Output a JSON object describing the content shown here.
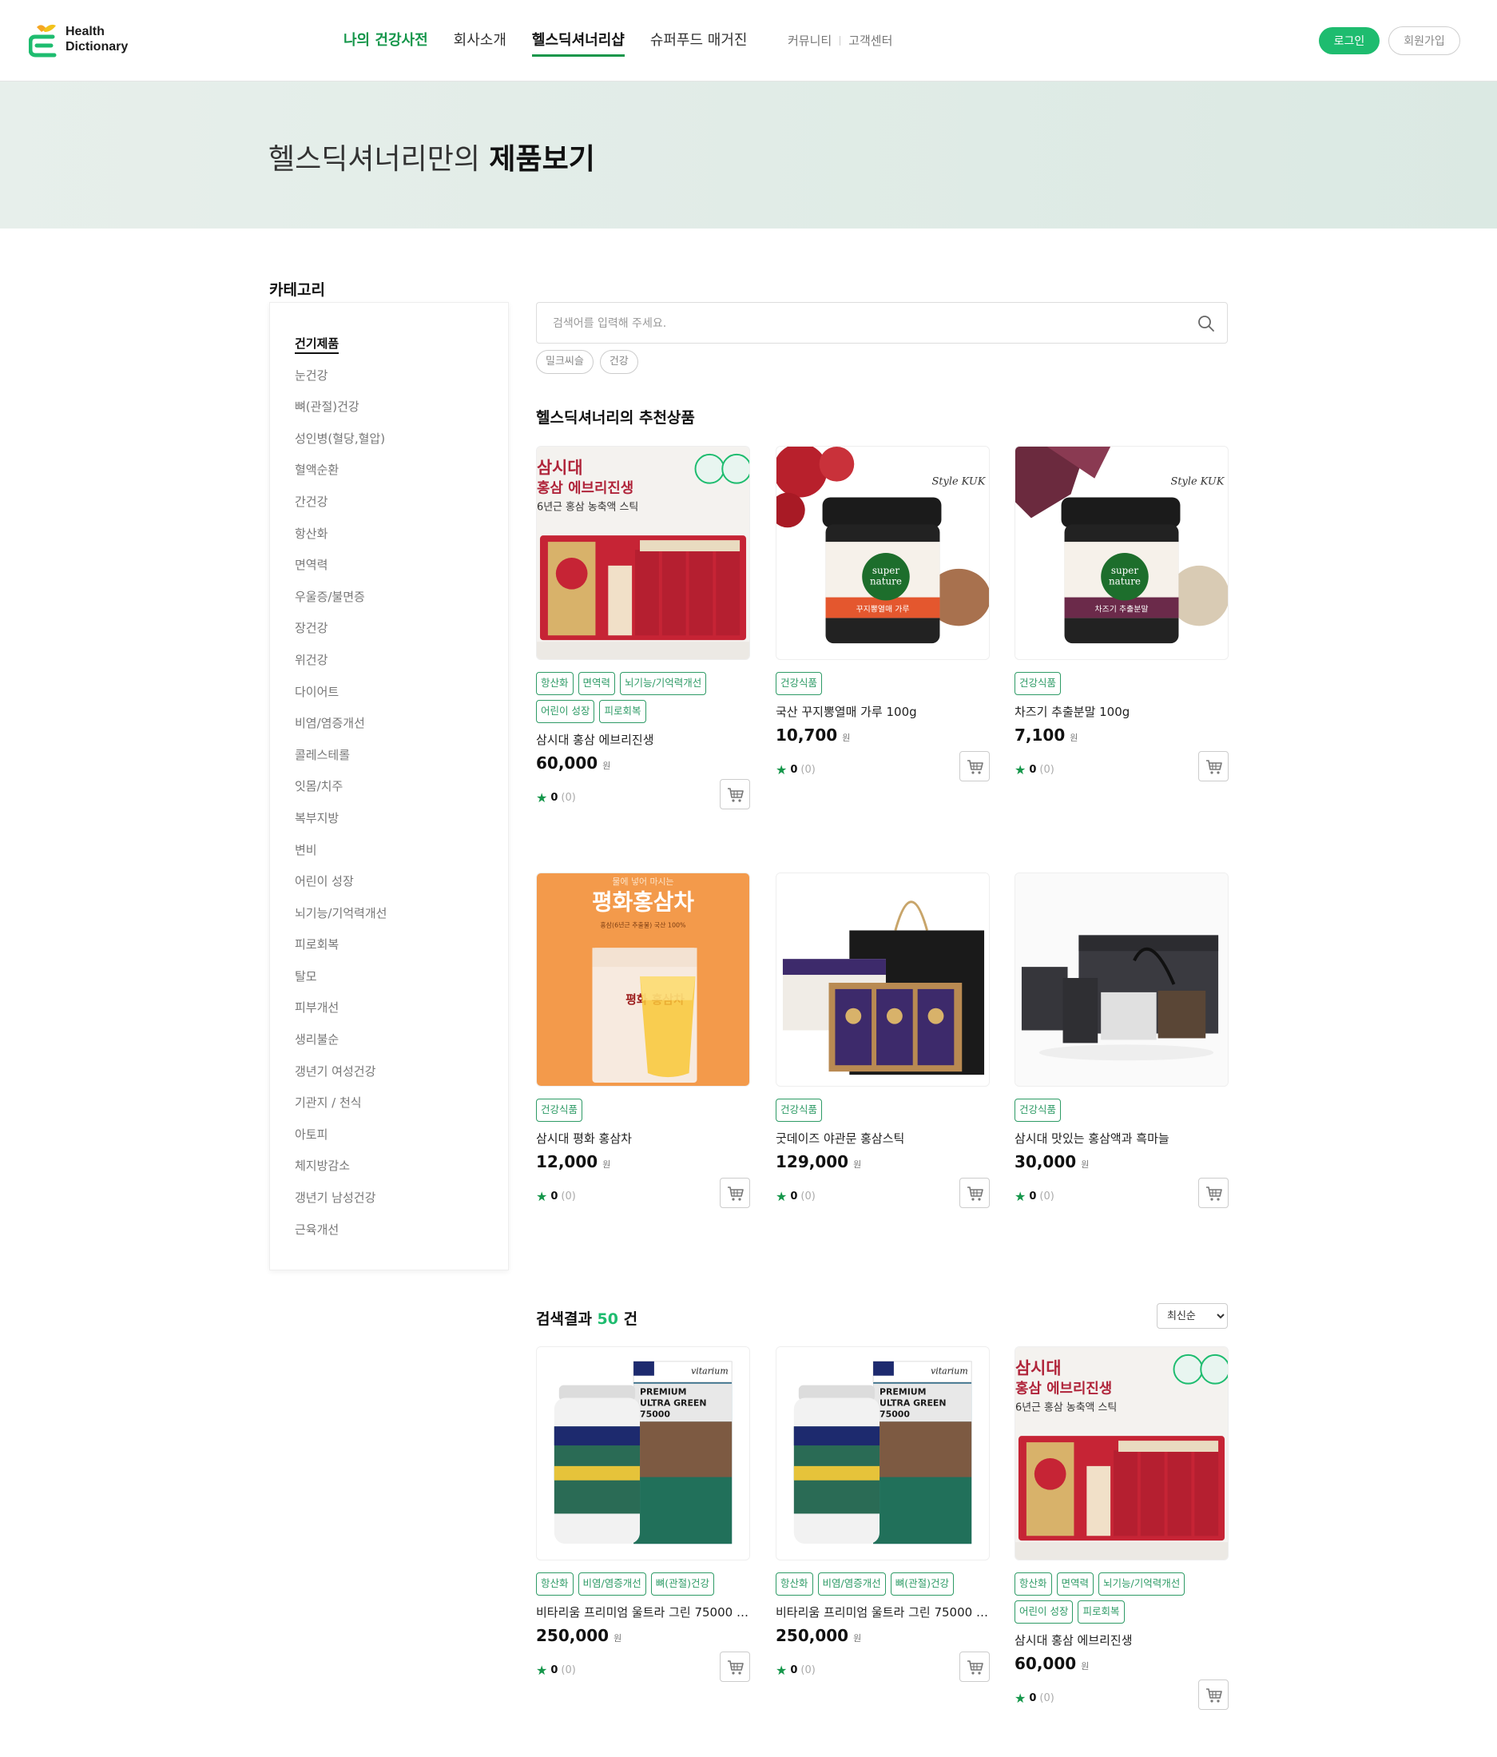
{
  "brand": {
    "line1": "Health",
    "line2": "Dictionary"
  },
  "nav": {
    "items": [
      "나의 건강사전",
      "회사소개",
      "헬스딕셔너리샵",
      "슈퍼푸드 매거진"
    ],
    "sub": [
      "커뮤니티",
      "고객센터"
    ],
    "login": "로그인",
    "join": "회원가입"
  },
  "hero": {
    "title_normal": "헬스딕셔너리만의 ",
    "title_bold": "제품보기"
  },
  "sidebar": {
    "title": "카테고리",
    "items": [
      "건기제품",
      "눈건강",
      "뼈(관절)건강",
      "성인병(혈당,혈압)",
      "혈액순환",
      "간건강",
      "항산화",
      "면역력",
      "우울증/불면증",
      "장건강",
      "위건강",
      "다이어트",
      "비염/염증개선",
      "콜레스테롤",
      "잇몸/치주",
      "복부지방",
      "변비",
      "어린이 성장",
      "뇌기능/기억력개선",
      "피로회복",
      "탈모",
      "피부개선",
      "생리불순",
      "갱년기 여성건강",
      "기관지 / 천식",
      "아토피",
      "체지방감소",
      "갱년기 남성건강",
      "근육개선"
    ]
  },
  "search": {
    "placeholder": "검색어를 입력해 주세요.",
    "chips": [
      "밀크씨슬",
      "건강"
    ]
  },
  "recommended": {
    "title": "헬스딕셔너리의 추천상품",
    "products": [
      {
        "name": "삼시대 홍삼 에브리진생",
        "price": "60,000",
        "unit": "원",
        "tags": [
          "항산화",
          "면역력",
          "뇌기능/기억력개선",
          "어린이 성장",
          "피로회복"
        ],
        "rating": "0",
        "count": "(0)"
      },
      {
        "name": "국산 꾸지뽕열매 가루 100g",
        "price": "10,700",
        "unit": "원",
        "tags": [
          "건강식품"
        ],
        "rating": "0",
        "count": "(0)"
      },
      {
        "name": "차즈기 추출분말 100g",
        "price": "7,100",
        "unit": "원",
        "tags": [
          "건강식품"
        ],
        "rating": "0",
        "count": "(0)"
      },
      {
        "name": "삼시대 평화 홍삼차",
        "price": "12,000",
        "unit": "원",
        "tags": [
          "건강식품"
        ],
        "rating": "0",
        "count": "(0)"
      },
      {
        "name": "굿데이즈 야관문 홍삼스틱",
        "price": "129,000",
        "unit": "원",
        "tags": [
          "건강식품"
        ],
        "rating": "0",
        "count": "(0)"
      },
      {
        "name": "삼시대 맛있는 홍삼액과 흑마늘",
        "price": "30,000",
        "unit": "원",
        "tags": [
          "건강식품"
        ],
        "rating": "0",
        "count": "(0)"
      }
    ]
  },
  "results": {
    "title_prefix": "검색결과 ",
    "count": "50",
    "title_suffix": " 건",
    "sort": "최신순",
    "products": [
      {
        "name": "비타리움 프리미엄 울트라 그린 75000 비...",
        "price": "250,000",
        "unit": "원",
        "tags": [
          "항산화",
          "비염/염증개선",
          "뼈(관절)건강"
        ],
        "rating": "0",
        "count": "(0)"
      },
      {
        "name": "비타리움 프리미엄 울트라 그린 75000 비...",
        "price": "250,000",
        "unit": "원",
        "tags": [
          "항산화",
          "비염/염증개선",
          "뼈(관절)건강"
        ],
        "rating": "0",
        "count": "(0)"
      },
      {
        "name": "삼시대 홍삼 에브리진생",
        "price": "60,000",
        "unit": "원",
        "tags": [
          "항산화",
          "면역력",
          "뇌기능/기억력개선",
          "어린이 성장",
          "피로회복"
        ],
        "rating": "0",
        "count": "(0)"
      }
    ]
  },
  "image_text": {
    "ginseng_l1": "삼시대",
    "ginseng_l2": "홍삼 에브리진생",
    "ginseng_l3": "6년근 홍삼 농축액 스틱",
    "jar_brand_1": "super",
    "jar_brand_2": "nature",
    "jar1_label": "꾸지뽕열매 가루",
    "jar2_label": "차즈기 추출분말",
    "stylekuk": "Style KUK",
    "tea_top": "물에 넣어 마시는",
    "tea_title": "평화홍삼차",
    "tea_sub": "홍삼(6년근 추출물) 국산 100%",
    "tea_box": "평화 홍삼차",
    "vit_brand": "vitarium",
    "vit_l1": "PREMIUM",
    "vit_l2": "ULTRA GREEN",
    "vit_l3": "75000"
  }
}
